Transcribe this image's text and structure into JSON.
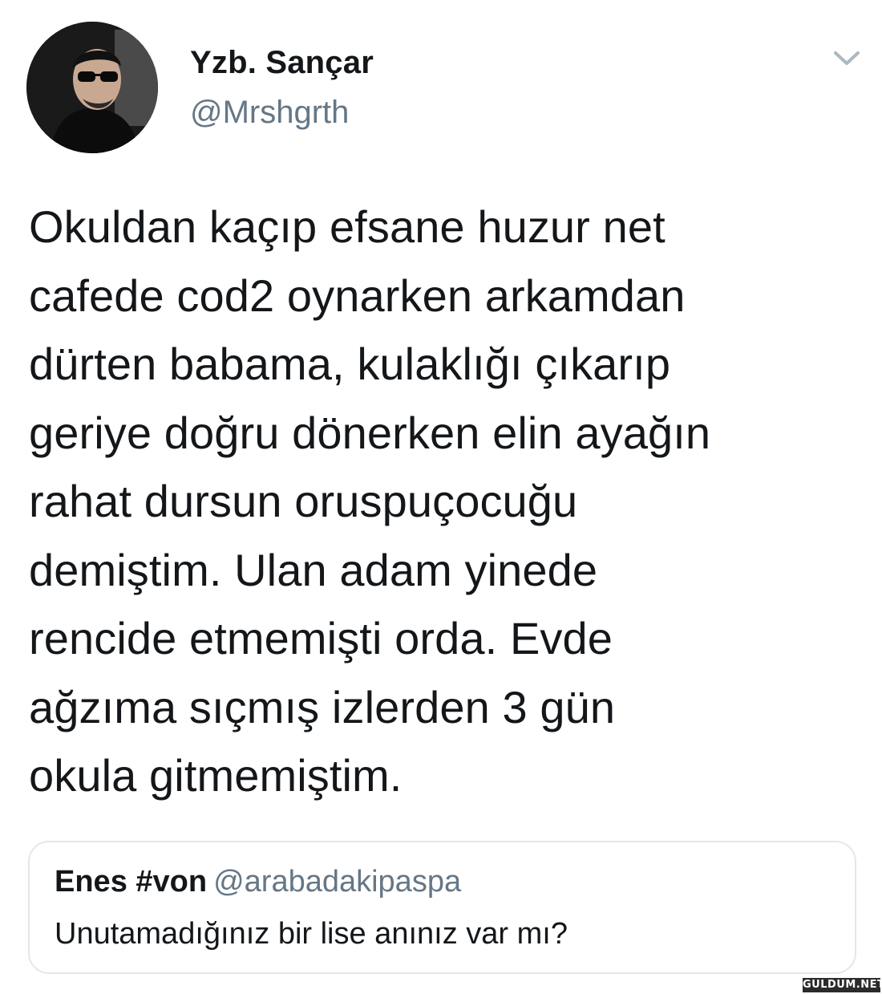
{
  "author": {
    "display_name": "Yzb. Sançar",
    "handle": "@Mrshgrth",
    "avatar_icon": "profile-photo"
  },
  "menu_icon": "chevron-down-icon",
  "tweet": {
    "lines": [
      "Okuldan kaçıp efsane huzur net",
      "cafede cod2 oynarken arkamdan",
      "dürten babama, kulaklığı çıkarıp",
      "geriye doğru dönerken elin ayağın",
      "rahat dursun oruspuçocuğu",
      "demiştim. Ulan adam yinede",
      "rencide etmemişti orda. Evde",
      "ağzıma sıçmış izlerden 3 gün",
      "okula gitmemiştim."
    ]
  },
  "quoted_tweet": {
    "display_name": "Enes #von",
    "handle": "@arabadakipaspa",
    "text": "Unutamadığınız bir lise anınız var mı?"
  },
  "watermark": "GULDUM.NET",
  "colors": {
    "primary_text": "#14171a",
    "secondary_text": "#657786",
    "border": "#e1e8ed",
    "chevron": "#aab8c2"
  }
}
